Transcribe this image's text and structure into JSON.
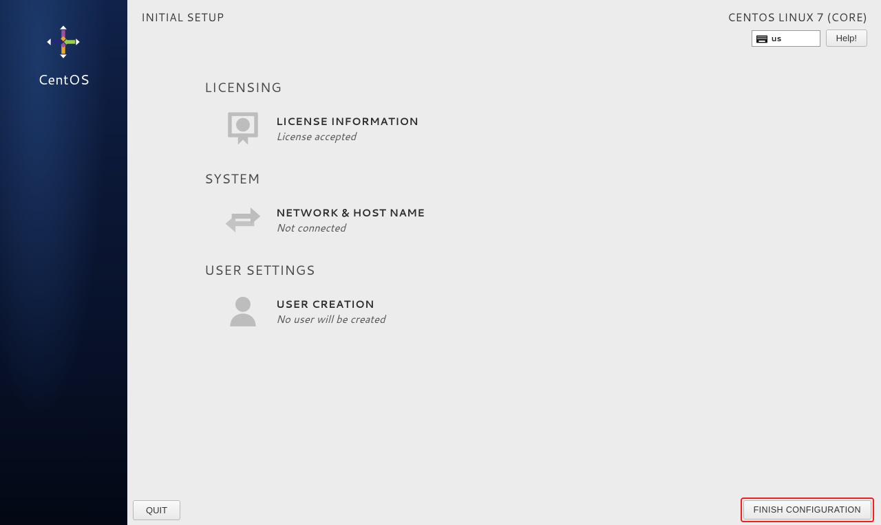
{
  "sidebar": {
    "brand": "CentOS"
  },
  "header": {
    "title": "INITIAL SETUP",
    "distro": "CENTOS LINUX 7 (CORE)",
    "keyboard_layout": "us",
    "help_label": "Help!"
  },
  "sections": {
    "licensing": {
      "heading": "LICENSING",
      "spoke": {
        "title": "LICENSE INFORMATION",
        "status": "License accepted"
      }
    },
    "system": {
      "heading": "SYSTEM",
      "spoke": {
        "title": "NETWORK & HOST NAME",
        "status": "Not connected"
      }
    },
    "user_settings": {
      "heading": "USER SETTINGS",
      "spoke": {
        "title": "USER CREATION",
        "status": "No user will be created"
      }
    }
  },
  "footer": {
    "quit_label": "QUIT",
    "finish_label": "FINISH CONFIGURATION"
  }
}
